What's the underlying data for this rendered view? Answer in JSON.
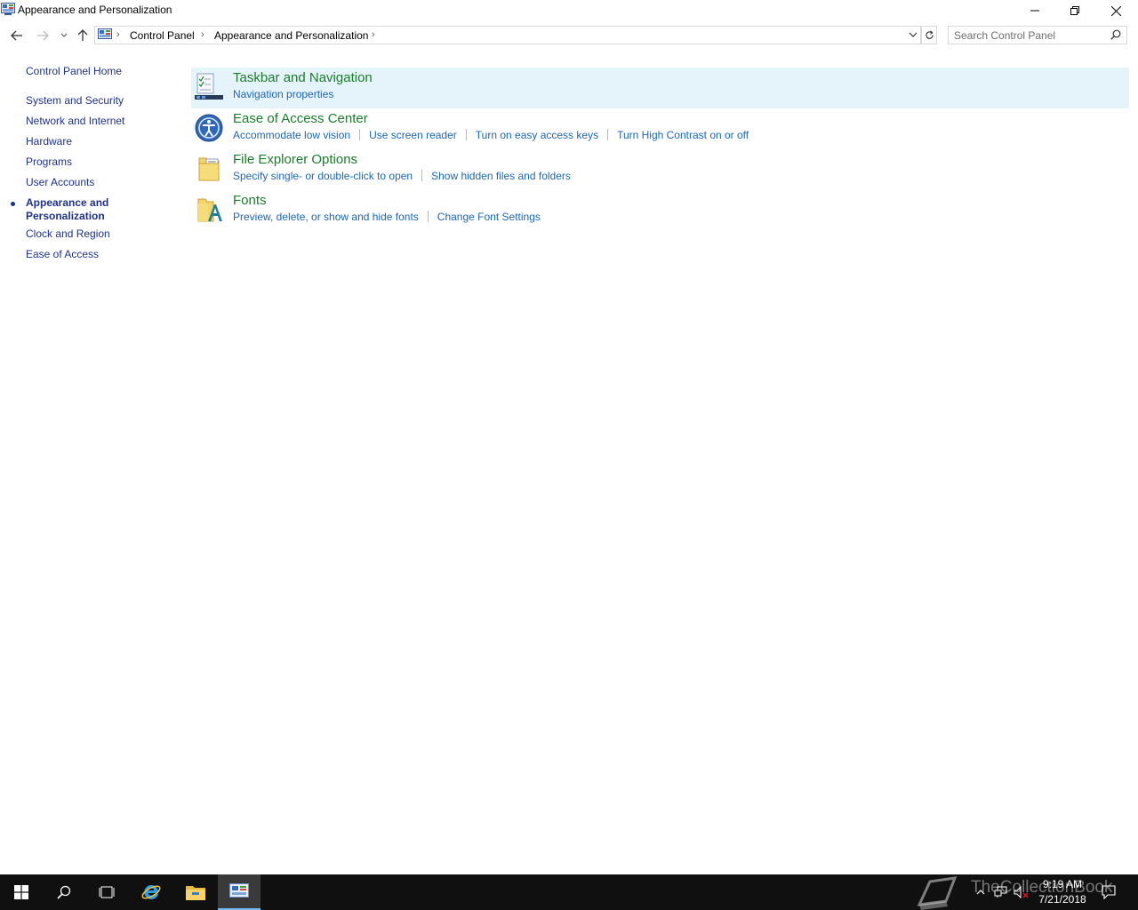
{
  "window": {
    "title": "Appearance and Personalization"
  },
  "address": {
    "crumbs": [
      "Control Panel",
      "Appearance and Personalization"
    ]
  },
  "search": {
    "placeholder": "Search Control Panel"
  },
  "sidebar": {
    "home": "Control Panel Home",
    "items": [
      {
        "label": "System and Security"
      },
      {
        "label": "Network and Internet"
      },
      {
        "label": "Hardware"
      },
      {
        "label": "Programs"
      },
      {
        "label": "User Accounts"
      },
      {
        "label": "Appearance and Personalization",
        "line1": "Appearance and",
        "line2": "Personalization",
        "current": true
      },
      {
        "label": "Clock and Region"
      },
      {
        "label": "Ease of Access"
      }
    ]
  },
  "tasks": [
    {
      "title": "Taskbar and Navigation",
      "icon": "taskbar-icon",
      "links": [
        "Navigation properties"
      ]
    },
    {
      "title": "Ease of Access Center",
      "icon": "ease-of-access-icon",
      "links": [
        "Accommodate low vision",
        "Use screen reader",
        "Turn on easy access keys",
        "Turn High Contrast on or off"
      ]
    },
    {
      "title": "File Explorer Options",
      "icon": "folder-options-icon",
      "links": [
        "Specify single- or double-click to open",
        "Show hidden files and folders"
      ]
    },
    {
      "title": "Fonts",
      "icon": "fonts-icon",
      "links": [
        "Preview, delete, or show and hide fonts",
        "Change Font Settings"
      ]
    }
  ],
  "taskbar": {
    "time": "9:19 AM",
    "date": "7/21/2018",
    "watermark": "TheCollectionBook",
    "accent": "#76b9ed"
  },
  "colors": {
    "link": "#1d67b3",
    "task_title": "#1b7c2a",
    "nav": "#1e3287",
    "highlight": "#e5f3fb"
  }
}
